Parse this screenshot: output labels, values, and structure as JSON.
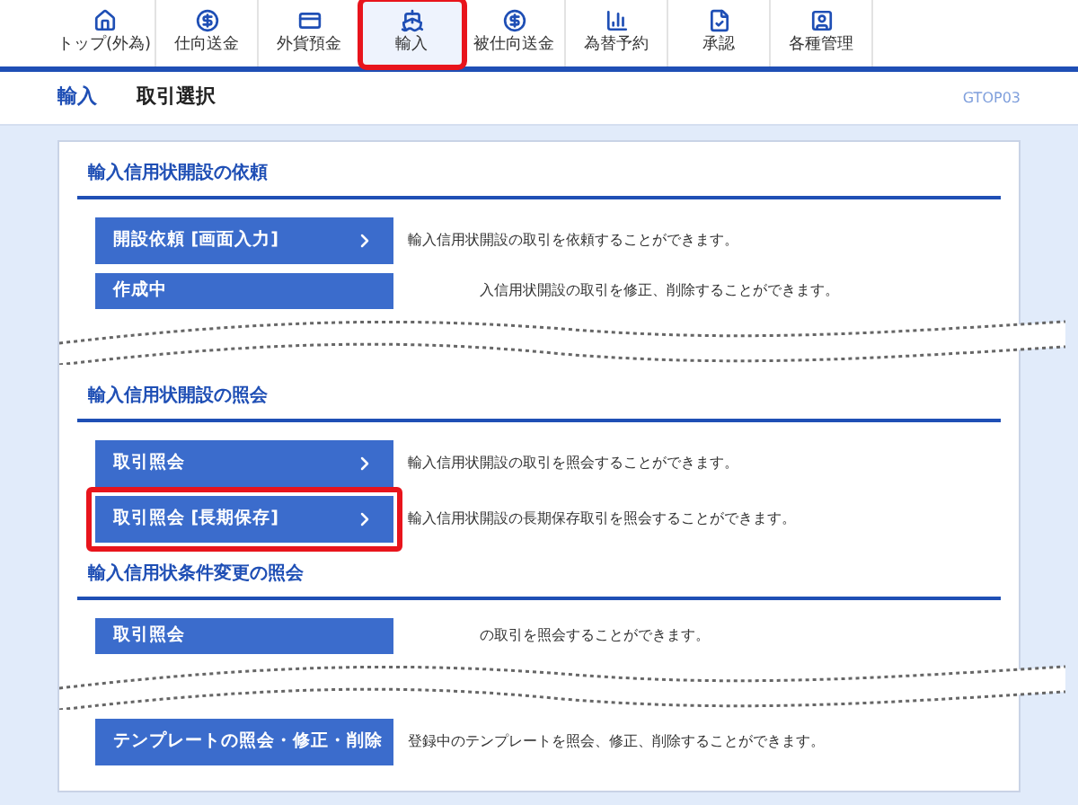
{
  "nav": {
    "tabs": [
      {
        "label": "トップ(外為)",
        "selected": false
      },
      {
        "label": "仕向送金",
        "selected": false
      },
      {
        "label": "外貨預金",
        "selected": false
      },
      {
        "label": "輸入",
        "selected": true
      },
      {
        "label": "被仕向送金",
        "selected": false
      },
      {
        "label": "為替予約",
        "selected": false
      },
      {
        "label": "承認",
        "selected": false
      },
      {
        "label": "各種管理",
        "selected": false
      }
    ]
  },
  "header": {
    "category": "輸入",
    "title": "取引選択",
    "screen_id": "GTOP03"
  },
  "sections": [
    {
      "title": "輸入信用状開設の依頼",
      "items": [
        {
          "kind": "row",
          "button": "開設依頼 [画面入力]",
          "description": "輸入信用状開設の取引を依頼することができます。",
          "highlighted": false
        },
        {
          "kind": "cut",
          "button": "作成中",
          "description": "入信用状開設の取引を修正、削除することができます。",
          "highlighted": false
        },
        {
          "kind": "break"
        }
      ]
    },
    {
      "title": "輸入信用状開設の照会",
      "items": [
        {
          "kind": "row",
          "button": "取引照会",
          "description": "輸入信用状開設の取引を照会することができます。",
          "highlighted": false
        },
        {
          "kind": "row",
          "button": "取引照会 [長期保存]",
          "description": "輸入信用状開設の長期保存取引を照会することができます。",
          "highlighted": true
        }
      ]
    },
    {
      "title": "輸入信用状条件変更の照会",
      "items": [
        {
          "kind": "cut",
          "button": "取引照会",
          "description": "の取引を照会することができます。",
          "highlighted": false
        },
        {
          "kind": "break"
        },
        {
          "kind": "row",
          "button": "テンプレートの照会・修正・削除",
          "description": "登録中のテンプレートを照会、修正、削除することができます。",
          "highlighted": false
        }
      ]
    }
  ]
}
